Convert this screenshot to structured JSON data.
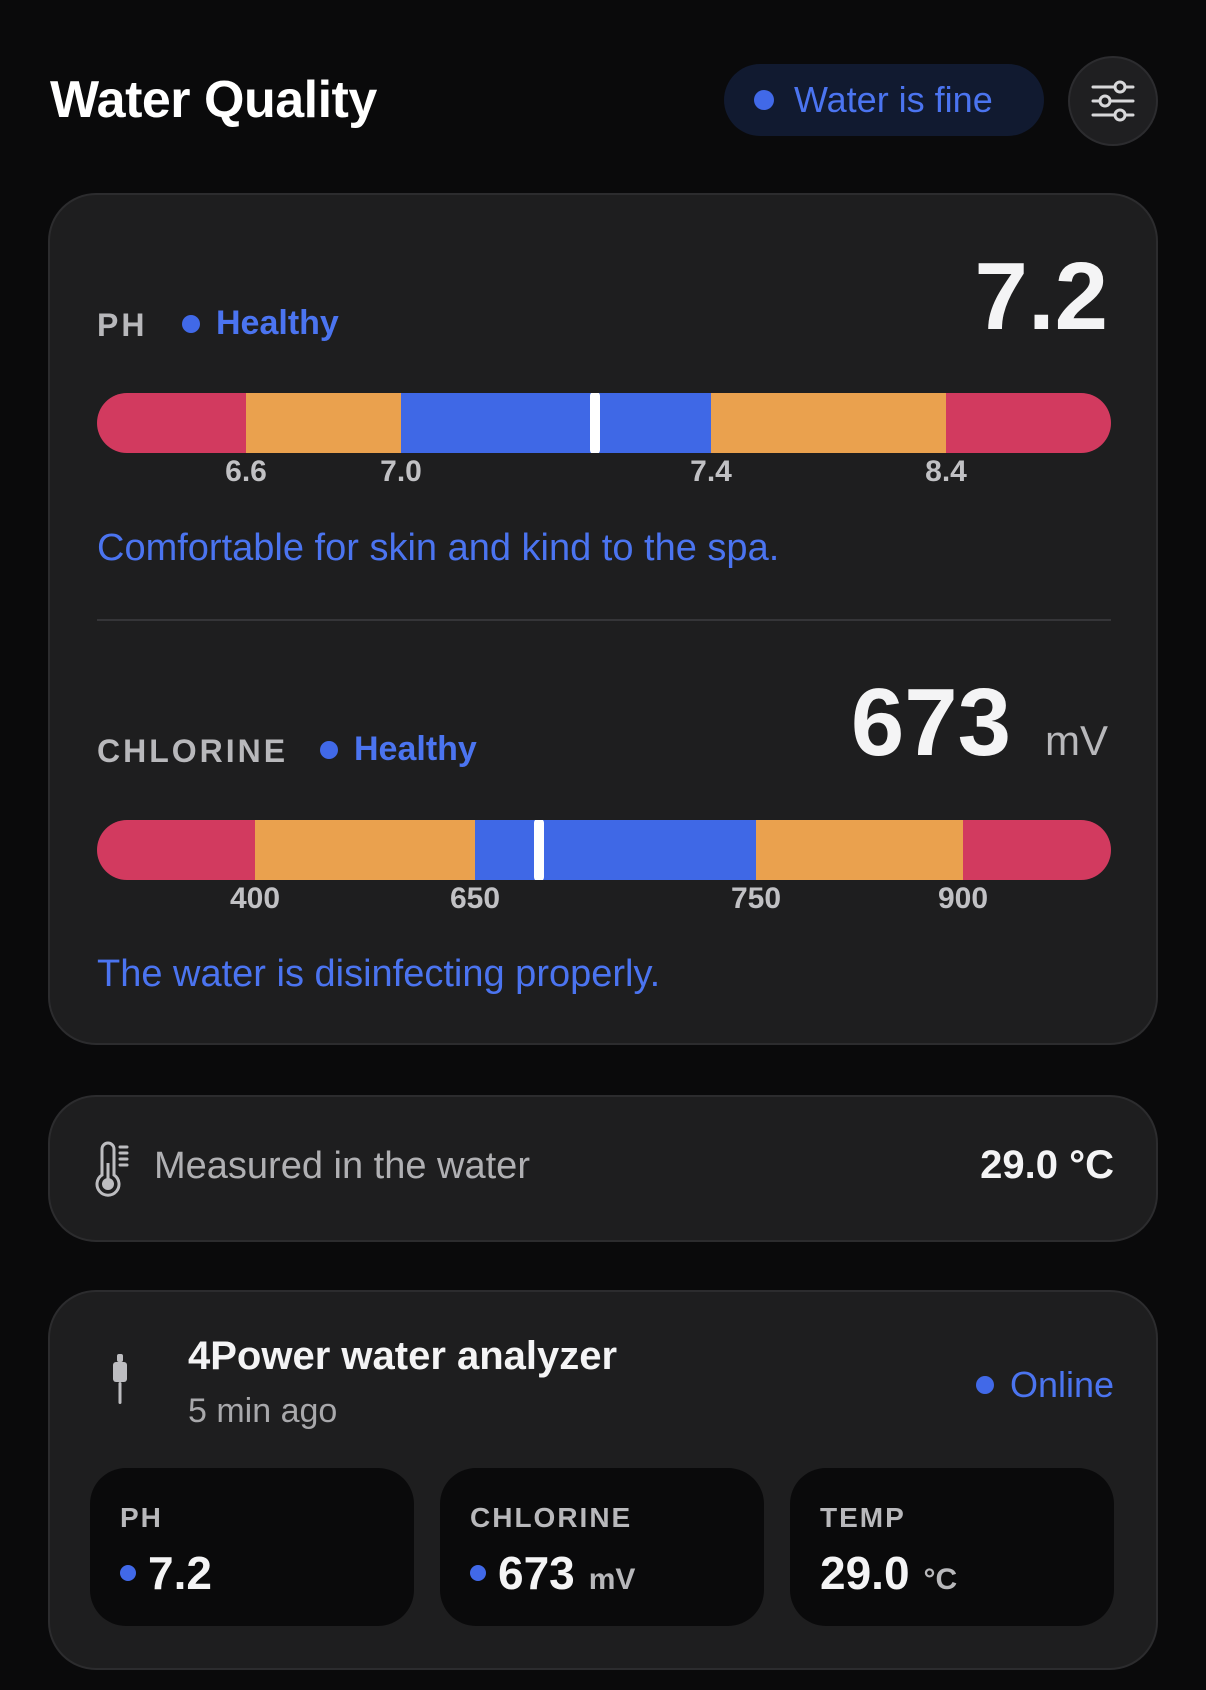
{
  "header": {
    "title": "Water Quality",
    "status_label": "Water is fine",
    "settings_icon": "sliders-icon"
  },
  "colors": {
    "accent": "#4b74f0",
    "range_bad": "#d23a5f",
    "range_warn": "#eaa14e",
    "range_ok": "#3f68e6",
    "card_bg": "#1e1e1f",
    "page_bg": "#0a0a0b"
  },
  "ph": {
    "label": "PH",
    "status": "Healthy",
    "value": "7.2",
    "thresholds": [
      "6.6",
      "7.0",
      "7.4",
      "8.4"
    ],
    "description": "Comfortable for skin and kind to the spa."
  },
  "chlorine": {
    "label": "CHLORINE",
    "status": "Healthy",
    "value": "673",
    "unit": "mV",
    "thresholds": [
      "400",
      "650",
      "750",
      "900"
    ],
    "description": "The water is disinfecting properly."
  },
  "temperature": {
    "icon": "thermometer-icon",
    "label": "Measured in the water",
    "value": "29.0 °C"
  },
  "device": {
    "icon": "probe-icon",
    "name": "4Power water analyzer",
    "updated": "5 min ago",
    "status": "Online",
    "tiles": [
      {
        "label": "PH",
        "value": "7.2",
        "unit": ""
      },
      {
        "label": "CHLORINE",
        "value": "673",
        "unit": "mV"
      },
      {
        "label": "TEMP",
        "value": "29.0",
        "unit": "°C"
      }
    ]
  }
}
